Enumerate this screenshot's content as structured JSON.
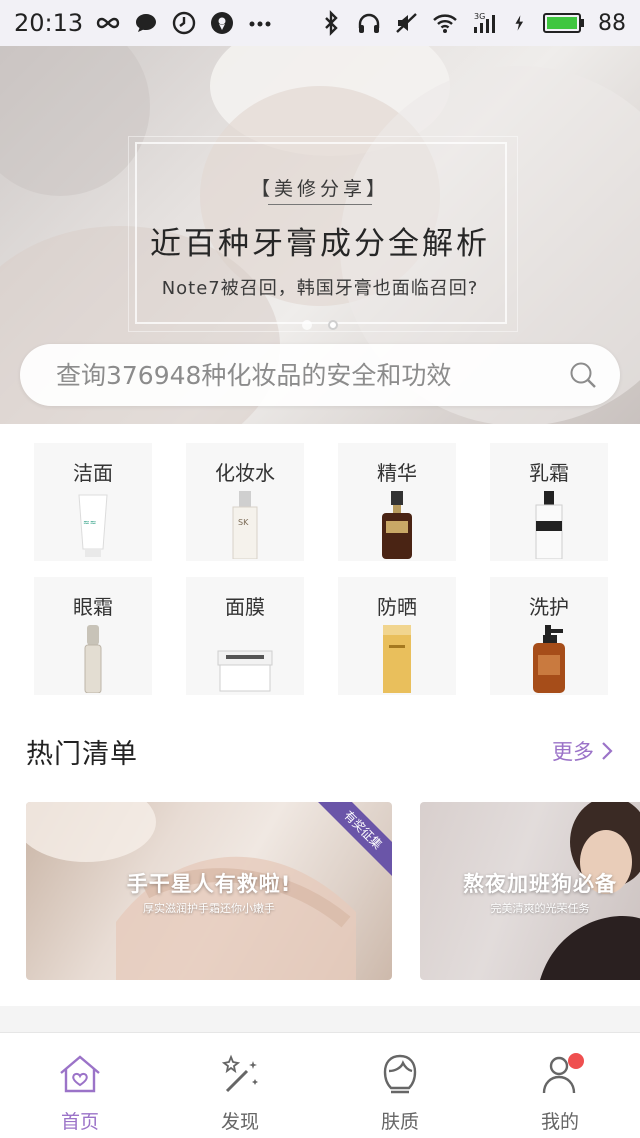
{
  "status_bar": {
    "time": "20:13",
    "battery": "88",
    "network": "3G",
    "icons": [
      "infinity-icon",
      "chat-icon",
      "clock-icon",
      "location-icon",
      "more-dots-icon",
      "bluetooth-icon",
      "headphones-icon",
      "mute-icon",
      "wifi-icon",
      "signal-icon",
      "charging-icon",
      "battery-icon"
    ]
  },
  "banner": {
    "tag": "【美修分享】",
    "title": "近百种牙膏成分全解析",
    "subtitle": "Note7被召回，韩国牙膏也面临召回?",
    "slide_count": 2,
    "active_slide": 2
  },
  "search": {
    "placeholder": "查询376948种化妆品的安全和功效"
  },
  "categories": [
    {
      "label": "洁面",
      "icon": "cleanser-tube-icon"
    },
    {
      "label": "化妆水",
      "icon": "toner-bottle-icon"
    },
    {
      "label": "精华",
      "icon": "serum-bottle-icon"
    },
    {
      "label": "乳霜",
      "icon": "cream-bottle-icon"
    },
    {
      "label": "眼霜",
      "icon": "eye-cream-icon"
    },
    {
      "label": "面膜",
      "icon": "mask-jar-icon"
    },
    {
      "label": "防晒",
      "icon": "sunscreen-icon"
    },
    {
      "label": "洗护",
      "icon": "shampoo-bottle-icon"
    }
  ],
  "hot_list": {
    "title": "热门清单",
    "more_label": "更多",
    "cards": [
      {
        "title": "手干星人有救啦!",
        "subtitle": "厚实滋润护手霜还你小嫩手",
        "ribbon": "有奖征集"
      },
      {
        "title": "熬夜加班狗必备",
        "subtitle": "完美清爽的光荣任务"
      }
    ]
  },
  "tabbar": {
    "items": [
      {
        "label": "首页",
        "icon": "home-icon",
        "active": true
      },
      {
        "label": "发现",
        "icon": "magic-wand-icon",
        "active": false
      },
      {
        "label": "肤质",
        "icon": "face-icon",
        "active": false
      },
      {
        "label": "我的",
        "icon": "profile-icon",
        "active": false,
        "badge": true
      }
    ]
  },
  "colors": {
    "accent": "#9b73c8",
    "badge": "#ef4f4f",
    "battery": "#3fc63f"
  }
}
